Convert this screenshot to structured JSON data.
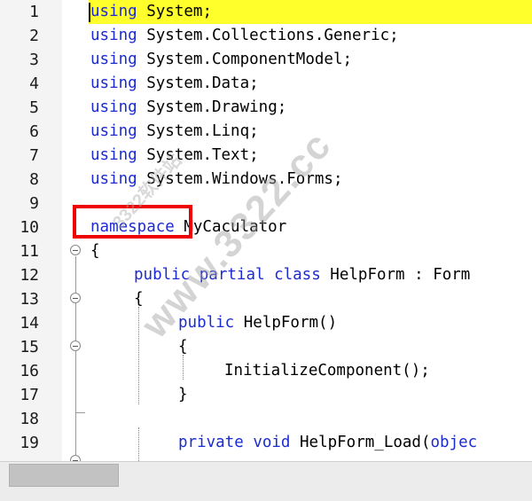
{
  "editor": {
    "lines": [
      {
        "num": "1",
        "kw": "using",
        "rest": " System;"
      },
      {
        "num": "2",
        "kw": "using",
        "rest": " System.Collections.Generic;"
      },
      {
        "num": "3",
        "kw": "using",
        "rest": " System.ComponentModel;"
      },
      {
        "num": "4",
        "kw": "using",
        "rest": " System.Data;"
      },
      {
        "num": "5",
        "kw": "using",
        "rest": " System.Drawing;"
      },
      {
        "num": "6",
        "kw": "using",
        "rest": " System.Linq;"
      },
      {
        "num": "7",
        "kw": "using",
        "rest": " System.Text;"
      },
      {
        "num": "8",
        "kw": "using",
        "rest": " System.Windows.Forms;"
      },
      {
        "num": "9",
        "kw": "",
        "rest": ""
      },
      {
        "num": "10",
        "kw": "namespace",
        "rest": " MyCaculator"
      },
      {
        "num": "11",
        "kw": "",
        "rest": "{"
      },
      {
        "num": "12",
        "kw": "",
        "rest": ""
      },
      {
        "num": "13",
        "kw": "",
        "rest": ""
      },
      {
        "num": "14",
        "kw": "",
        "rest": ""
      },
      {
        "num": "15",
        "kw": "",
        "rest": ""
      },
      {
        "num": "16",
        "kw": "",
        "rest": ""
      },
      {
        "num": "17",
        "kw": "",
        "rest": ""
      },
      {
        "num": "18",
        "kw": "",
        "rest": ""
      },
      {
        "num": "19",
        "kw": "",
        "rest": ""
      }
    ],
    "line12": {
      "kw1": "public",
      "sp1": " ",
      "kw2": "partial",
      "sp2": " ",
      "kw3": "class",
      "rest": " HelpForm : Form"
    },
    "line13": "{",
    "line14": {
      "kw": "public",
      "rest": " HelpForm()"
    },
    "line15": "{",
    "line16": "InitializeComponent();",
    "line17": "}",
    "line19": {
      "kw1": "private",
      "sp": " ",
      "kw2": "void",
      "rest": " HelpForm_Load(",
      "kw3": "objec"
    },
    "highlighted_line": "1"
  },
  "watermark": {
    "text": "www.3322.cc",
    "subtext": "3322软件站"
  },
  "colors": {
    "keyword": "#1c2bd1",
    "highlight": "#ffff2b",
    "box": "#ee0000"
  }
}
